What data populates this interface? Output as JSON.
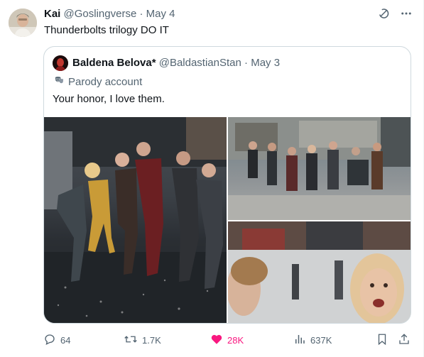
{
  "tweet": {
    "author_name": "Kai",
    "author_handle": "@Goslingverse",
    "separator": "·",
    "date": "May 4",
    "text": "Thunderbolts trilogy DO IT"
  },
  "quoted": {
    "author_name": "Baldena Belova*",
    "author_handle": "@BaldastianStan",
    "separator": "·",
    "date": "May 3",
    "parody_label": "Parody account",
    "text": "Your honor, I love them."
  },
  "actions": {
    "replies": "64",
    "reposts": "1.7K",
    "likes": "28K",
    "views": "637K"
  },
  "colors": {
    "like_active": "#f91880",
    "muted": "#536471",
    "border": "#cfd9de"
  },
  "icons": [
    "grok-icon",
    "more-icon",
    "theater-masks-icon",
    "reply-icon",
    "repost-icon",
    "heart-icon",
    "views-icon",
    "bookmark-icon",
    "share-icon"
  ]
}
